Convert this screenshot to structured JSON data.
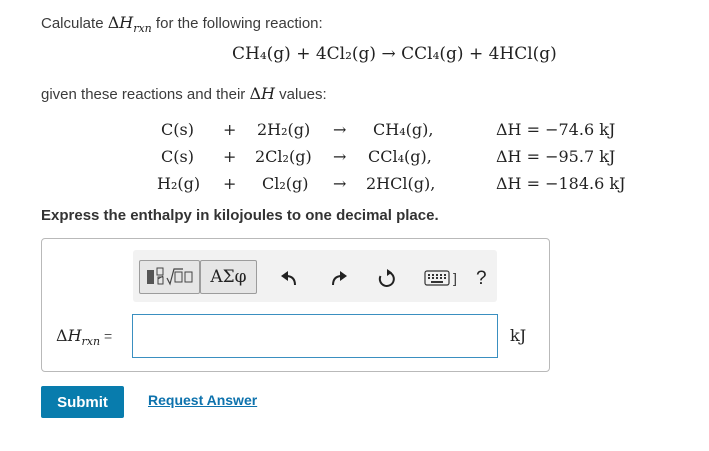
{
  "question": {
    "prefix": "Calculate ",
    "suffix": " for the following reaction:",
    "delta": "Δ",
    "H": "H",
    "rxn_sub": "rxn"
  },
  "main_reaction": "CH₄(g) + 4Cl₂(g) → CCl₄(g) + 4HCl(g)",
  "given": {
    "prefix": "given these reactions and their ",
    "suffix": " values:",
    "delta": "Δ",
    "H": "H"
  },
  "reactions": [
    {
      "lhs1": "C(s)",
      "plus": "+",
      "lhs2": "2H₂(g)",
      "arrow": "→",
      "product": "CH₄(g),",
      "dh": "ΔH = −74.6 kJ"
    },
    {
      "lhs1": "C(s)",
      "plus": "+",
      "lhs2": "2Cl₂(g)",
      "arrow": "→",
      "product": "CCl₄(g),",
      "dh": "ΔH = −95.7 kJ"
    },
    {
      "lhs1": "H₂(g)",
      "plus": "+",
      "lhs2": "Cl₂(g)",
      "arrow": "→",
      "product": "2HCl(g),",
      "dh": "ΔH = −184.6 kJ"
    }
  ],
  "instruction": "Express the enthalpy in kilojoules to one decimal place.",
  "toolbar": {
    "templates_icon": "templates-icon",
    "greek_label": "ΑΣφ",
    "undo_icon": "undo-icon",
    "redo_icon": "redo-icon",
    "reset_icon": "reset-icon",
    "keyboard_icon": "keyboard-icon",
    "keyboard_suffix": "]",
    "help_label": "?"
  },
  "answer": {
    "label_delta": "Δ",
    "label_H": "H",
    "label_sub": "rxn",
    "label_eq": " =",
    "value": "",
    "unit": "kJ"
  },
  "buttons": {
    "submit": "Submit",
    "request_answer": "Request Answer"
  },
  "colors": {
    "accent": "#087cad",
    "link": "#0d72ad",
    "input_border": "#3a8fc0"
  }
}
